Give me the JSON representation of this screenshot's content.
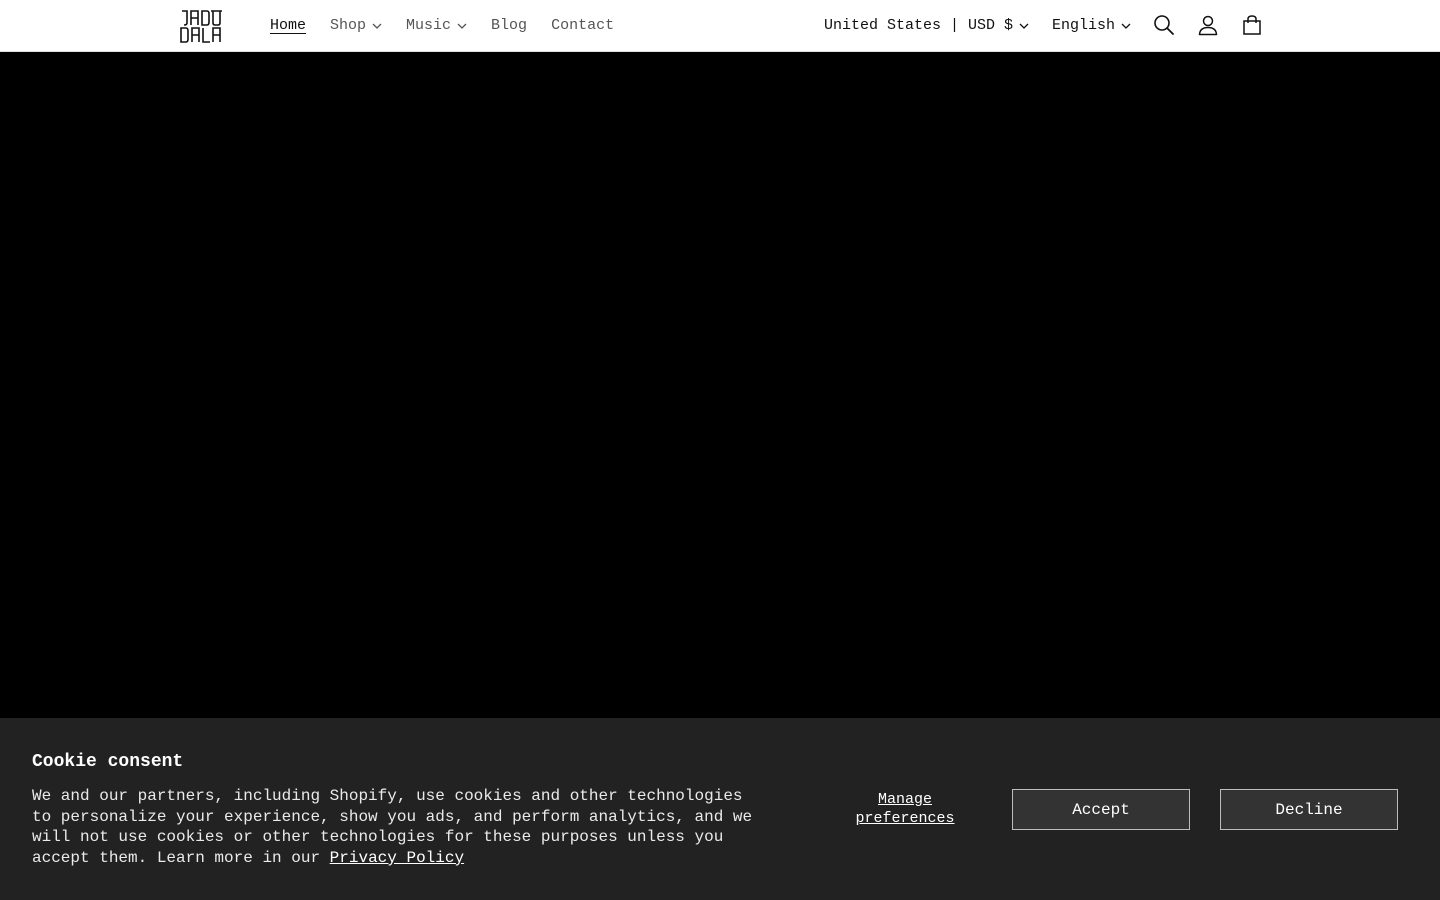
{
  "header": {
    "logo_text": [
      "JADU",
      "DALA"
    ],
    "nav": [
      {
        "label": "Home",
        "active": true,
        "has_dropdown": false
      },
      {
        "label": "Shop",
        "active": false,
        "has_dropdown": true
      },
      {
        "label": "Music",
        "active": false,
        "has_dropdown": true
      },
      {
        "label": "Blog",
        "active": false,
        "has_dropdown": false
      },
      {
        "label": "Contact",
        "active": false,
        "has_dropdown": false
      }
    ],
    "country_selector": "United States | USD $",
    "language_selector": "English",
    "icons": [
      "search-icon",
      "account-icon",
      "cart-icon"
    ]
  },
  "hero": {
    "background_color": "#000000"
  },
  "cookie_banner": {
    "title": "Cookie consent",
    "body": "We and our partners, including Shopify, use cookies and other technologies to personalize your experience, show you ads, and perform analytics, and we will not use cookies or other technologies for these purposes unless you accept them. Learn more in our ",
    "privacy_link": "Privacy Policy",
    "manage_label": "Manage preferences",
    "accept_label": "Accept",
    "decline_label": "Decline",
    "background_color": "#222222"
  }
}
